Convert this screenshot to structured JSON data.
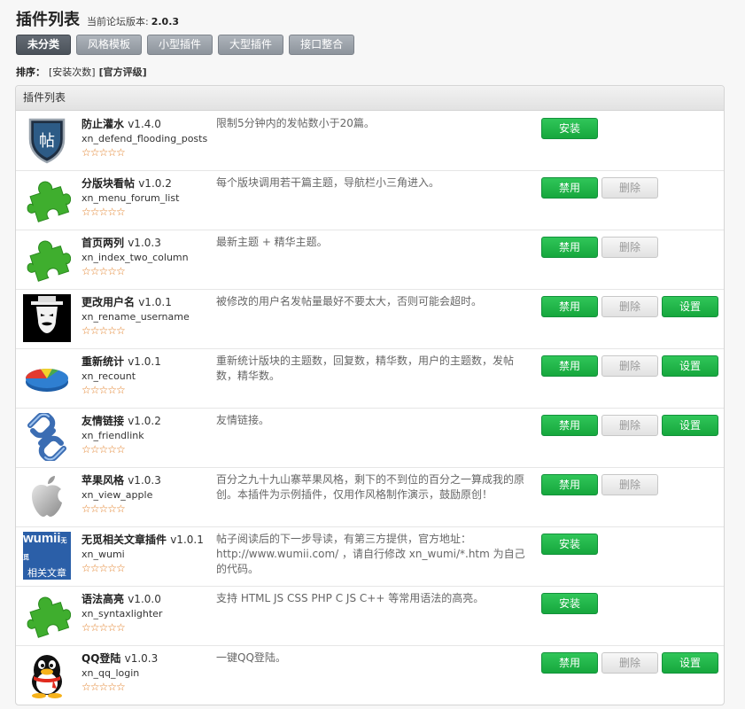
{
  "header": {
    "title": "插件列表",
    "version_label": "当前论坛版本:",
    "version_value": "2.0.3"
  },
  "tabs": [
    {
      "label": "未分类",
      "active": true
    },
    {
      "label": "风格模板",
      "active": false
    },
    {
      "label": "小型插件",
      "active": false
    },
    {
      "label": "大型插件",
      "active": false
    },
    {
      "label": "接口整合",
      "active": false
    }
  ],
  "sort": {
    "label": "排序：",
    "options": [
      {
        "label": "[安装次数]",
        "active": false
      },
      {
        "label": "[官方评级]",
        "active": true
      }
    ]
  },
  "panel": {
    "title": "插件列表"
  },
  "stars_text": "☆☆☆☆☆",
  "plugins": [
    {
      "name": "防止灌水",
      "version": "v1.4.0",
      "id": "xn_defend_flooding_posts",
      "icon": "shield-icon",
      "desc": "限制5分钟内的发帖数小于20篇。",
      "buttons": [
        {
          "label": "安装",
          "kind": "green"
        }
      ]
    },
    {
      "name": "分版块看帖",
      "version": "v1.0.2",
      "id": "xn_menu_forum_list",
      "icon": "puzzle-icon",
      "desc": "每个版块调用若干篇主题，导航栏小三角进入。",
      "buttons": [
        {
          "label": "禁用",
          "kind": "green"
        },
        {
          "label": "删除",
          "kind": "gray"
        }
      ]
    },
    {
      "name": "首页两列",
      "version": "v1.0.3",
      "id": "xn_index_two_column",
      "icon": "puzzle-icon",
      "desc": "最新主题 + 精华主题。",
      "buttons": [
        {
          "label": "禁用",
          "kind": "green"
        },
        {
          "label": "删除",
          "kind": "gray"
        }
      ]
    },
    {
      "name": "更改用户名",
      "version": "v1.0.1",
      "id": "xn_rename_username",
      "icon": "anonymous-mask-icon",
      "desc": "被修改的用户名发帖量最好不要太大，否则可能会超时。",
      "buttons": [
        {
          "label": "禁用",
          "kind": "green"
        },
        {
          "label": "删除",
          "kind": "gray"
        },
        {
          "label": "设置",
          "kind": "green"
        }
      ]
    },
    {
      "name": "重新统计",
      "version": "v1.0.1",
      "id": "xn_recount",
      "icon": "pie-chart-icon",
      "desc": "重新统计版块的主题数，回复数，精华数，用户的主题数，发帖数，精华数。",
      "buttons": [
        {
          "label": "禁用",
          "kind": "green"
        },
        {
          "label": "删除",
          "kind": "gray"
        },
        {
          "label": "设置",
          "kind": "green"
        }
      ]
    },
    {
      "name": "友情链接",
      "version": "v1.0.2",
      "id": "xn_friendlink",
      "icon": "chain-link-icon",
      "desc": "友情链接。",
      "buttons": [
        {
          "label": "禁用",
          "kind": "green"
        },
        {
          "label": "删除",
          "kind": "gray"
        },
        {
          "label": "设置",
          "kind": "green"
        }
      ]
    },
    {
      "name": "苹果风格",
      "version": "v1.0.3",
      "id": "xn_view_apple",
      "icon": "apple-icon",
      "desc": "百分之九十九山寨苹果风格，剩下的不到位的百分之一算成我的原创。本插件为示例插件，仅用作风格制作演示，鼓励原创！",
      "buttons": [
        {
          "label": "禁用",
          "kind": "green"
        },
        {
          "label": "删除",
          "kind": "gray"
        }
      ]
    },
    {
      "name": "无觅相关文章插件",
      "version": "v1.0.1",
      "id": "xn_wumi",
      "icon": "wumii-logo-icon",
      "logo_text": {
        "top": "wumii",
        "top_small": "无觅",
        "bottom": "相关文章"
      },
      "desc": "帖子阅读后的下一步导读，有第三方提供，官方地址：http://www.wumii.com/ ，请自行修改 xn_wumi/*.htm 为自己的代码。",
      "buttons": [
        {
          "label": "安装",
          "kind": "green"
        }
      ]
    },
    {
      "name": "语法高亮",
      "version": "v1.0.0",
      "id": "xn_syntaxlighter",
      "icon": "puzzle-icon",
      "desc": "支持 HTML JS CSS PHP C JS C++ 等常用语法的高亮。",
      "buttons": [
        {
          "label": "安装",
          "kind": "green"
        }
      ]
    },
    {
      "name": "QQ登陆",
      "version": "v1.0.3",
      "id": "xn_qq_login",
      "icon": "qq-penguin-icon",
      "desc": "一键QQ登陆。",
      "buttons": [
        {
          "label": "禁用",
          "kind": "green"
        },
        {
          "label": "删除",
          "kind": "gray"
        },
        {
          "label": "设置",
          "kind": "green"
        }
      ]
    }
  ]
}
